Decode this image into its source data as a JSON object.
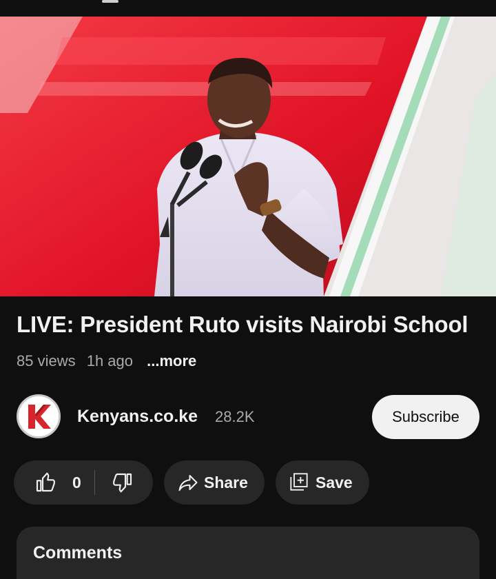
{
  "video": {
    "title": "LIVE: President Ruto visits Nairobi School",
    "views": "85 views",
    "age": "1h ago",
    "more": "...more",
    "progress_fraction": 0.005
  },
  "channel": {
    "name": "Kenyans.co.ke",
    "subscribers": "28.2K",
    "logo_letter": "K",
    "subscribe_label": "Subscribe"
  },
  "actions": {
    "like_count": "0",
    "share_label": "Share",
    "save_label": "Save"
  },
  "comments": {
    "title": "Comments"
  },
  "colors": {
    "background": "#0f0f0f",
    "pill": "#272727",
    "accent_red": "#ff0000",
    "text_primary": "#f1f1f1",
    "text_secondary": "#aaaaaa",
    "logo_red": "#d7262b"
  },
  "icons": [
    "menu-icon",
    "thumbs-up-icon",
    "thumbs-down-icon",
    "share-arrow-icon",
    "save-playlist-icon"
  ]
}
